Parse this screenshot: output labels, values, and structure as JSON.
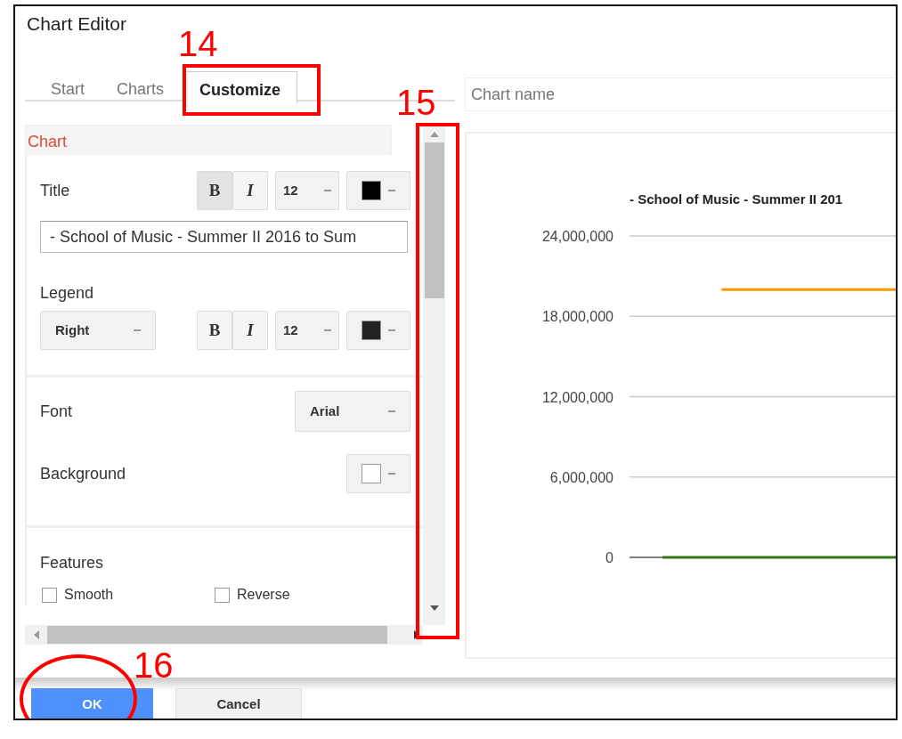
{
  "window": {
    "title": "Chart Editor"
  },
  "tabs": [
    {
      "label": "Start",
      "selected": false
    },
    {
      "label": "Charts",
      "selected": false
    },
    {
      "label": "Customize",
      "selected": true
    }
  ],
  "panel": {
    "section": "Chart",
    "title_row": {
      "label": "Title",
      "bold_label": "B",
      "italic_label": "I",
      "bold": true,
      "italic": false,
      "size": "12",
      "color": "#000000",
      "value": "- School of Music - Summer II 2016 to Sum"
    },
    "legend_row": {
      "label": "Legend",
      "position": "Right",
      "bold_label": "B",
      "italic_label": "I",
      "bold": false,
      "italic": false,
      "size": "12",
      "color": "#222222"
    },
    "font_row": {
      "label": "Font",
      "value": "Arial"
    },
    "background_row": {
      "label": "Background",
      "color": "#ffffff"
    },
    "features": {
      "label": "Features",
      "options": [
        {
          "label": "Smooth",
          "checked": false
        },
        {
          "label": "Reverse",
          "checked": false
        }
      ]
    }
  },
  "chart": {
    "name_placeholder": "Chart name",
    "chart_data": {
      "type": "line",
      "grid": true,
      "title": "- School of Music - Summer II 201",
      "ylim": [
        0,
        24000000
      ],
      "yticks": [
        {
          "value": 0,
          "label": "0"
        },
        {
          "value": 6000000,
          "label": "6,000,000"
        },
        {
          "value": 12000000,
          "label": "12,000,000"
        },
        {
          "value": 18000000,
          "label": "18,000,000"
        },
        {
          "value": 24000000,
          "label": "24,000,000"
        }
      ],
      "series": [
        {
          "color": "#ff9900",
          "values": [
            null,
            20000000,
            20000000,
            20000000,
            20000000
          ]
        },
        {
          "color": "#38761d",
          "values": [
            0,
            0,
            0,
            0,
            0
          ]
        }
      ]
    }
  },
  "buttons": [
    {
      "label": "OK",
      "kind": "primary"
    },
    {
      "label": "Cancel",
      "kind": "secondary"
    }
  ],
  "annotations": [
    {
      "label": "14"
    },
    {
      "label": "15"
    },
    {
      "label": "16"
    }
  ]
}
